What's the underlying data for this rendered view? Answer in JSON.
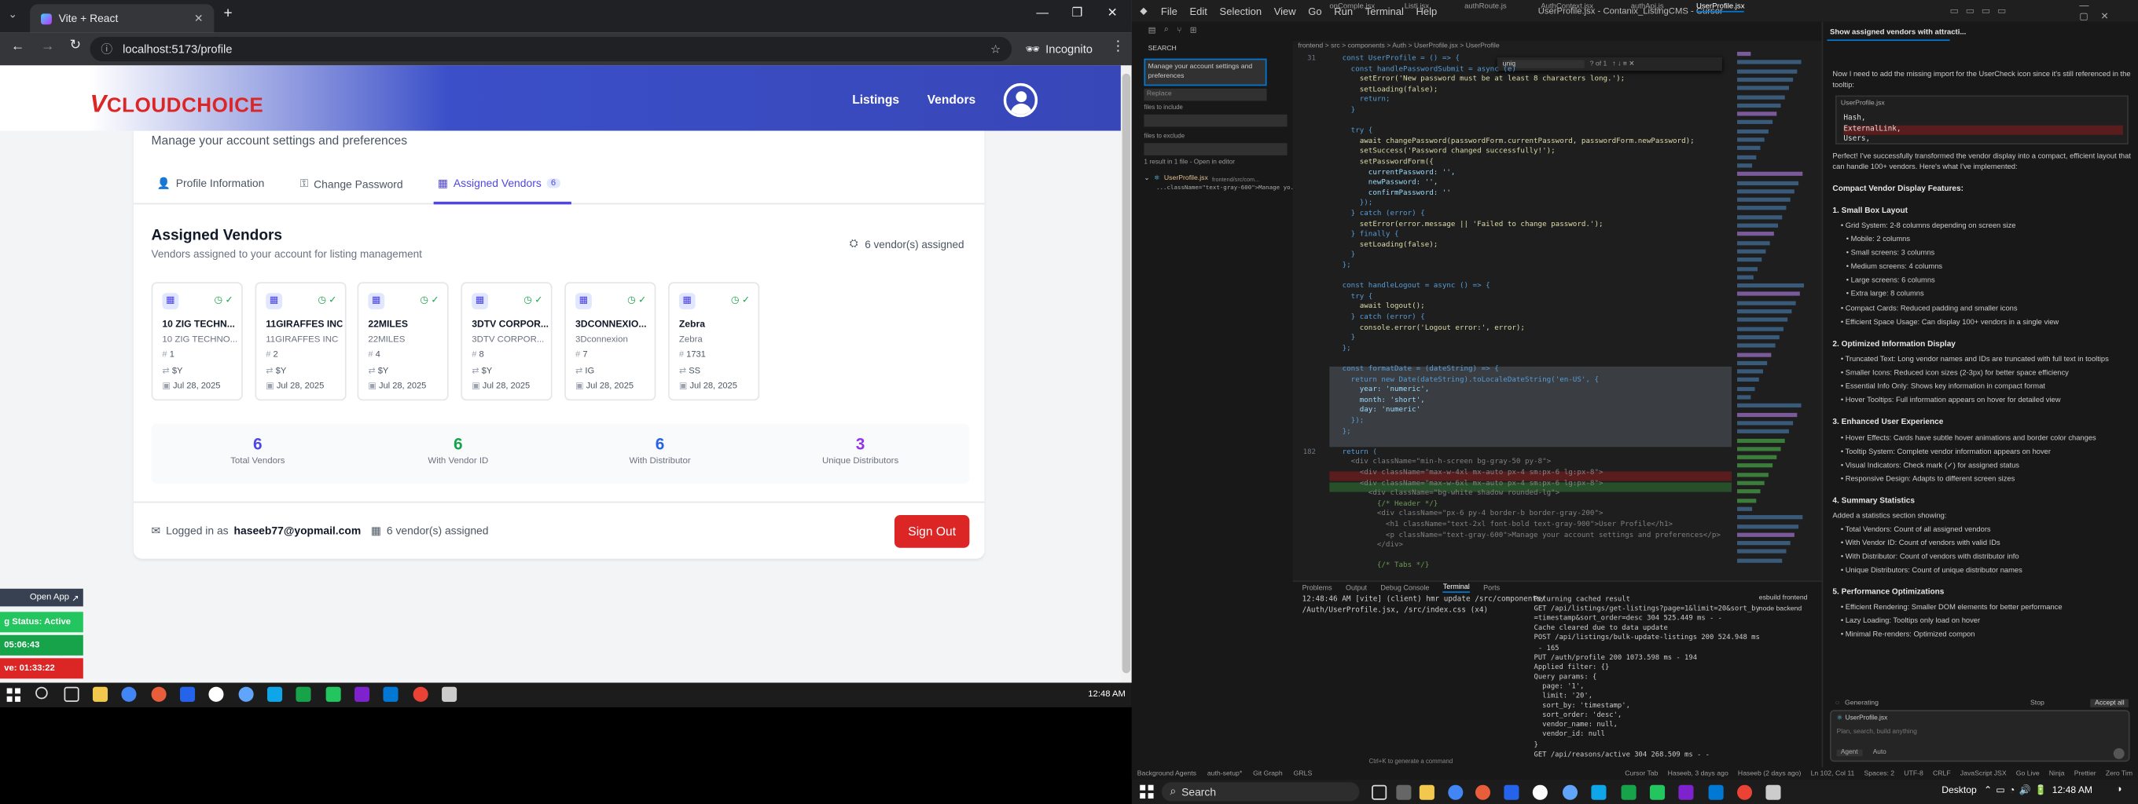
{
  "browser": {
    "tab_title": "Vite + React",
    "url": "localhost:5173/profile",
    "incognito_label": "Incognito"
  },
  "site": {
    "logo_v": "V",
    "logo_cloud": "CLOUD",
    "logo_choice": "CHOICE",
    "nav": [
      "Listings",
      "Vendors"
    ]
  },
  "profile": {
    "subtitle": "Manage your account settings and preferences",
    "tabs": [
      {
        "label": "Profile Information"
      },
      {
        "label": "Change Password"
      },
      {
        "label": "Assigned Vendors",
        "badge": "6"
      }
    ],
    "section_title": "Assigned Vendors",
    "section_desc": "Vendors assigned to your account for listing management",
    "assigned_summary": "6 vendor(s) assigned",
    "vendors": [
      {
        "name": "10 ZIG TECHN...",
        "sub": "10 ZIG TECHNO...",
        "id": "1",
        "dist": "$Y",
        "date": "Jul 28, 2025"
      },
      {
        "name": "11GIRAFFES INC",
        "sub": "11GIRAFFES INC",
        "id": "2",
        "dist": "$Y",
        "date": "Jul 28, 2025"
      },
      {
        "name": "22MILES",
        "sub": "22MILES",
        "id": "4",
        "dist": "$Y",
        "date": "Jul 28, 2025"
      },
      {
        "name": "3DTV CORPOR...",
        "sub": "3DTV CORPOR...",
        "id": "8",
        "dist": "$Y",
        "date": "Jul 28, 2025"
      },
      {
        "name": "3DCONNEXIO...",
        "sub": "3Dconnexion",
        "id": "7",
        "dist": "IG",
        "date": "Jul 28, 2025"
      },
      {
        "name": "Zebra",
        "sub": "Zebra",
        "id": "1731",
        "dist": "SS",
        "date": "Jul 28, 2025"
      }
    ],
    "stats": [
      {
        "value": "6",
        "label": "Total Vendors",
        "color": "#4f46e5"
      },
      {
        "value": "6",
        "label": "With Vendor ID",
        "color": "#16a34a"
      },
      {
        "value": "6",
        "label": "With Distributor",
        "color": "#2563eb"
      },
      {
        "value": "3",
        "label": "Unique Distributors",
        "color": "#9333ea"
      }
    ],
    "logged_in_prefix": "Logged in as",
    "email": "haseeb77@yopmail.com",
    "footer_assigned": "6 vendor(s) assigned",
    "sign_out": "Sign Out"
  },
  "overlay": {
    "open_app": "Open App",
    "status": "g Status: Active",
    "time1": "05:06:43",
    "time2": "ve: 01:33:22"
  },
  "taskbar_left": {
    "time": "12:48 AM"
  },
  "ide": {
    "title": "UserProfile.jsx - Contanix_ListingCMS - Cursor",
    "menu": [
      "File",
      "Edit",
      "Selection",
      "View",
      "Go",
      "Run",
      "Terminal",
      "Help"
    ],
    "search_label": "SEARCH",
    "search_query": "Manage your account settings and preferences",
    "replace_placeholder": "Replace",
    "files_include": "files to include",
    "files_exclude": "files to exclude",
    "result_summary": "1 result in 1 file - Open in editor",
    "result_file": "UserProfile.jsx",
    "result_path": "frontend/src/com...",
    "result_line": "...className=\"text-gray-600\">Manage yo...",
    "editor_tabs": [
      "onComple.jsx",
      "Listi.jsx",
      "authRoute.js",
      "AuthContext.jsx",
      "authApi.js",
      "UserProfile.jsx"
    ],
    "breadcrumb": "frontend > src > components > Auth > UserProfile.jsx > UserProfile",
    "find_query": "uniq",
    "find_count": "? of 1",
    "code_lines": [
      {
        "n": "31",
        "t": "  const UserProfile = () => {"
      },
      {
        "n": "",
        "t": "    const handlePasswordSubmit = async (e)"
      },
      {
        "n": "",
        "t": "      setError('New password must be at least 8 characters long.');"
      },
      {
        "n": "",
        "t": "      setLoading(false);"
      },
      {
        "n": "",
        "t": "      return;"
      },
      {
        "n": "",
        "t": "    }"
      },
      {
        "n": "",
        "t": ""
      },
      {
        "n": "",
        "t": "    try {"
      },
      {
        "n": "",
        "t": "      await changePassword(passwordForm.currentPassword, passwordForm.newPassword);"
      },
      {
        "n": "",
        "t": "      setSuccess('Password changed successfully!');"
      },
      {
        "n": "",
        "t": "      setPasswordForm({"
      },
      {
        "n": "",
        "t": "        currentPassword: '',"
      },
      {
        "n": "",
        "t": "        newPassword: '',"
      },
      {
        "n": "",
        "t": "        confirmPassword: ''"
      },
      {
        "n": "",
        "t": "      });"
      },
      {
        "n": "",
        "t": "    } catch (error) {"
      },
      {
        "n": "",
        "t": "      setError(error.message || 'Failed to change password.');"
      },
      {
        "n": "",
        "t": "    } finally {"
      },
      {
        "n": "",
        "t": "      setLoading(false);"
      },
      {
        "n": "",
        "t": "    }"
      },
      {
        "n": "",
        "t": "  };"
      },
      {
        "n": "",
        "t": ""
      },
      {
        "n": "",
        "t": "  const handleLogout = async () => {"
      },
      {
        "n": "",
        "t": "    try {"
      },
      {
        "n": "",
        "t": "      await logout();"
      },
      {
        "n": "",
        "t": "    } catch (error) {"
      },
      {
        "n": "",
        "t": "      console.error('Logout error:', error);"
      },
      {
        "n": "",
        "t": "    }"
      },
      {
        "n": "",
        "t": "  };"
      },
      {
        "n": "",
        "t": ""
      },
      {
        "n": "",
        "t": "  const formatDate = (dateString) => {"
      },
      {
        "n": "",
        "t": "    return new Date(dateString).toLocaleDateString('en-US', {"
      },
      {
        "n": "",
        "t": "      year: 'numeric',"
      },
      {
        "n": "",
        "t": "      month: 'short',"
      },
      {
        "n": "",
        "t": "      day: 'numeric'"
      },
      {
        "n": "",
        "t": "    });"
      },
      {
        "n": "",
        "t": "  };"
      },
      {
        "n": "",
        "t": ""
      },
      {
        "n": "182",
        "t": "  return ("
      },
      {
        "n": "",
        "t": "    <div className=\"min-h-screen bg-gray-50 py-8\">"
      },
      {
        "n": "",
        "t": "      <div className=\"max-w-4xl mx-auto px-4 sm:px-6 lg:px-8\">"
      },
      {
        "n": "",
        "t": "      <div className=\"max-w-6xl mx-auto px-4 sm:px-6 lg:px-8\">"
      },
      {
        "n": "",
        "t": "        <div className=\"bg-white shadow rounded-lg\">"
      },
      {
        "n": "",
        "t": "          {/* Header */}"
      },
      {
        "n": "",
        "t": "          <div className=\"px-6 py-4 border-b border-gray-200\">"
      },
      {
        "n": "",
        "t": "            <h1 className=\"text-2xl font-bold text-gray-900\">User Profile</h1>"
      },
      {
        "n": "",
        "t": "            <p className=\"text-gray-600\">Manage your account settings and preferences</p>"
      },
      {
        "n": "",
        "t": "          </div>"
      },
      {
        "n": "",
        "t": ""
      },
      {
        "n": "",
        "t": "          {/* Tabs */}"
      }
    ],
    "terminal_tabs": [
      "Problems",
      "Output",
      "Debug Console",
      "Terminal",
      "Ports"
    ],
    "terminal_left": [
      "12:48:46 AM [vite] (client) hmr update /src/components/",
      "/Auth/UserProfile.jsx, /src/index.css (x4)"
    ],
    "terminal_right": [
      "Returning cached result",
      "GET /api/listings/get-listings?page=1&limit=20&sort_by",
      "=timestamp&sort_order=desc 304 525.449 ms - -",
      "Cache cleared due to data update",
      "POST /api/listings/bulk-update-listings 200 524.948 ms",
      " - 165",
      "PUT /auth/profile 200 1073.598 ms - 194",
      "Applied filter: {}",
      "Query params: {",
      "  page: '1',",
      "  limit: '20',",
      "  sort_by: 'timestamp',",
      "  sort_order: 'desc',",
      "  vendor_name: null,",
      "  vendor_id: null",
      "}",
      "GET /api/reasons/active 304 268.509 ms - -"
    ],
    "terminal_hint": "Ctrl+K to generate a command",
    "shells": [
      "esbuild frontend",
      "node backend"
    ],
    "chat_title": "Show assigned vendors with attracti...",
    "chat_items": [
      {
        "cls": "",
        "t": "Now I need to add the missing import for the UserCheck icon since it's still referenced in the"
      },
      {
        "cls": "",
        "t": "tooltip:"
      },
      {
        "cls": "",
        "t": "Perfect! I've successfully transformed the vendor display into a compact, efficient layout that"
      },
      {
        "cls": "",
        "t": "can handle 100+ vendors. Here's what I've implemented:"
      },
      {
        "cls": "b",
        "t": "Compact Vendor Display Features:"
      },
      {
        "cls": "b",
        "t": "1. Small Box Layout"
      },
      {
        "cls": "li",
        "t": "• Grid System: 2-8 columns depending on screen size"
      },
      {
        "cls": "li2",
        "t": "• Mobile: 2 columns"
      },
      {
        "cls": "li2",
        "t": "• Small screens: 3 columns"
      },
      {
        "cls": "li2",
        "t": "• Medium screens: 4 columns"
      },
      {
        "cls": "li2",
        "t": "• Large screens: 6 columns"
      },
      {
        "cls": "li2",
        "t": "• Extra large: 8 columns"
      },
      {
        "cls": "li",
        "t": "• Compact Cards: Reduced padding and smaller icons"
      },
      {
        "cls": "li",
        "t": "• Efficient Space Usage: Can display 100+ vendors in a single view"
      },
      {
        "cls": "b",
        "t": "2. Optimized Information Display"
      },
      {
        "cls": "li",
        "t": "• Truncated Text: Long vendor names and IDs are truncated with full text in tooltips"
      },
      {
        "cls": "li",
        "t": "• Smaller Icons: Reduced icon sizes (2-3px) for better space efficiency"
      },
      {
        "cls": "li",
        "t": "• Essential Info Only: Shows key information in compact format"
      },
      {
        "cls": "li",
        "t": "• Hover Tooltips: Full information appears on hover for detailed view"
      },
      {
        "cls": "b",
        "t": "3. Enhanced User Experience"
      },
      {
        "cls": "li",
        "t": "• Hover Effects: Cards have subtle hover animations and border color changes"
      },
      {
        "cls": "li",
        "t": "• Tooltip System: Complete vendor information appears on hover"
      },
      {
        "cls": "li",
        "t": "• Visual Indicators: Check mark (✓) for assigned status"
      },
      {
        "cls": "li",
        "t": "• Responsive Design: Adapts to different screen sizes"
      },
      {
        "cls": "b",
        "t": "4. Summary Statistics"
      },
      {
        "cls": "",
        "t": "Added a statistics section showing:"
      },
      {
        "cls": "li",
        "t": "• Total Vendors: Count of all assigned vendors"
      },
      {
        "cls": "li",
        "t": "• With Vendor ID: Count of vendors with valid IDs"
      },
      {
        "cls": "li",
        "t": "• With Distributor: Count of vendors with distributor info"
      },
      {
        "cls": "li",
        "t": "• Unique Distributors: Count of unique distributor names"
      },
      {
        "cls": "b",
        "t": "5. Performance Optimizations"
      },
      {
        "cls": "li",
        "t": "• Efficient Rendering: Smaller DOM elements for better performance"
      },
      {
        "cls": "li",
        "t": "• Lazy Loading: Tooltips only load on hover"
      },
      {
        "cls": "li",
        "t": "• Minimal Re-renders: Optimized compon"
      }
    ],
    "code_snippet": [
      "Hash,",
      "ExternalLink,",
      "Users,"
    ],
    "generating": "Generating",
    "stop_label": "Stop",
    "accept_all": "Accept all",
    "chat_file": "UserProfile.jsx",
    "chat_placeholder": "Plan, search, build anything",
    "agent_label": "Agent",
    "auto_label": "Auto",
    "statusbar_left": [
      "Background Agents",
      "auth-setup*",
      "Git Graph",
      "GRLS"
    ],
    "statusbar_right": [
      "Cursor Tab",
      "Haseeb, 3 days ago",
      "Haseeb (2 days ago)",
      "Ln 102, Col 11",
      "Spaces: 2",
      "UTF-8",
      "CRLF",
      "JavaScript JSX",
      "Go Live",
      "Ninja",
      "Prettier",
      "Zero Tim"
    ]
  },
  "taskbar_right": {
    "search": "Search",
    "desktop": "Desktop",
    "time": "12:48 AM"
  }
}
